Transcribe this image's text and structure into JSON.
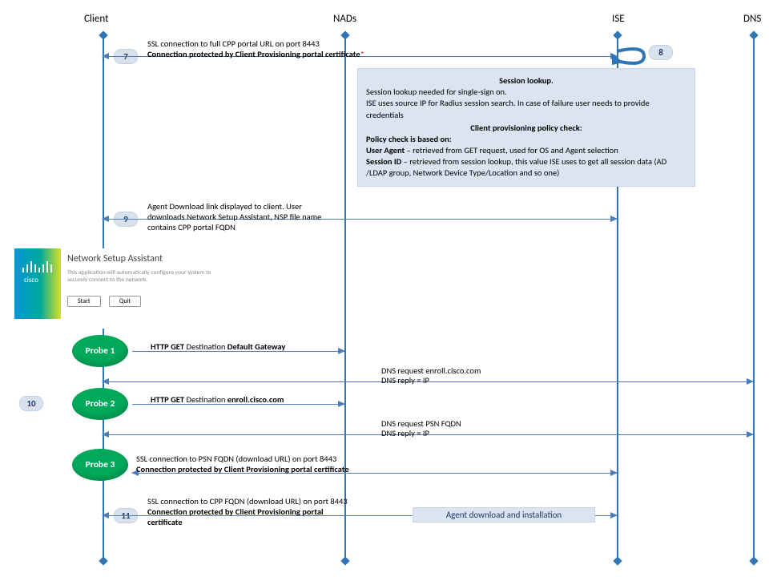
{
  "heads": {
    "client": "Client",
    "nads": "NADs",
    "ise": "ISE",
    "dns": "DNS"
  },
  "steps": {
    "s7": "7",
    "s8": "8",
    "s9": "9",
    "s10": "10",
    "s11": "11"
  },
  "probes": {
    "p1": "Probe 1",
    "p2": "Probe 2",
    "p3": "Probe 3"
  },
  "m7": {
    "l1": "SSL connection to full CPP portal URL on port 8443",
    "l2": "Connection protected by Client Provisioning portal certificate",
    "star": "*"
  },
  "box": {
    "title1": "Session lookup.",
    "l1": "Session lookup needed for single-sign on.",
    "l2": "ISE uses source IP for Radius session search. In case of failure user needs to provide credentials",
    "title2": "Client provisioning policy check:",
    "l3": "Policy check is based on:",
    "l4a": "User Agent",
    "l4b": " – retrieved from GET request, used for OS and Agent selection",
    "l5a": "Session ID",
    "l5b": " – retrieved from session lookup, this value ISE uses to get all session data (AD /LDAP group, Network Device Type/Location and so one)"
  },
  "m9": {
    "l1": "Agent Download link displayed to client. User",
    "l2": "downloads Network Setup Assistant, NSP file name",
    "l3": "contains CPP portal FQDN"
  },
  "nsa": {
    "brand": "cisco",
    "title": "Network Setup Assistant",
    "desc": "This application will automatically configure your system to securely connect to the network.",
    "start": "Start",
    "quit": "Quit"
  },
  "p1": {
    "a": "HTTP GET",
    "b": "Destination",
    "c": "Default Gateway"
  },
  "dns1": {
    "req": "DNS request enroll.cisco.com",
    "rep": "DNS reply = IP"
  },
  "p2": {
    "a": "HTTP GET",
    "b": "Destination",
    "c": "enroll.cisco.com"
  },
  "dns2": {
    "req": "DNS request PSN FQDN",
    "rep": "DNS reply = IP"
  },
  "p3": {
    "l1": "SSL connection to PSN FQDN (download URL) on port 8443",
    "l2": "Connection protected by Client Provisioning portal certificate"
  },
  "m11": {
    "l1": "SSL connection to CPP FQDN (download URL) on port 8443",
    "l2": "Connection protected by Client Provisioning portal",
    "l3": "certificate",
    "box": "Agent download and installation"
  }
}
